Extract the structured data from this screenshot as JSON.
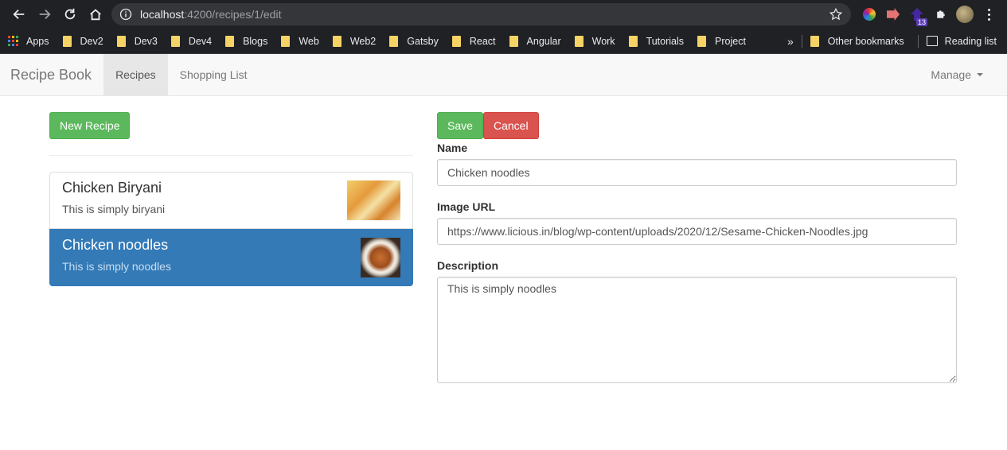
{
  "browser": {
    "url_host": "localhost",
    "url_rest": ":4200/recipes/1/edit",
    "extension_badge": "13",
    "bookmarks": [
      "Dev2",
      "Dev3",
      "Dev4",
      "Blogs",
      "Web",
      "Web2",
      "Gatsby",
      "React",
      "Angular",
      "Work",
      "Tutorials",
      "Project"
    ],
    "apps_label": "Apps",
    "overflow": "»",
    "other_bookmarks": "Other bookmarks",
    "reading_list": "Reading list"
  },
  "navbar": {
    "brand": "Recipe Book",
    "recipes": "Recipes",
    "shopping_list": "Shopping List",
    "manage": "Manage"
  },
  "list": {
    "new_button": "New Recipe",
    "items": [
      {
        "name": "Chicken Biryani",
        "description": "This is simply biryani"
      },
      {
        "name": "Chicken noodles",
        "description": "This is simply noodles"
      }
    ]
  },
  "form": {
    "save": "Save",
    "cancel": "Cancel",
    "name_label": "Name",
    "name_value": "Chicken noodles",
    "image_label": "Image URL",
    "image_value": "https://www.licious.in/blog/wp-content/uploads/2020/12/Sesame-Chicken-Noodles.jpg",
    "description_label": "Description",
    "description_value": "This is simply noodles"
  },
  "colors": {
    "success": "#5cb85c",
    "danger": "#d9534f",
    "active_item": "#337ab7"
  }
}
